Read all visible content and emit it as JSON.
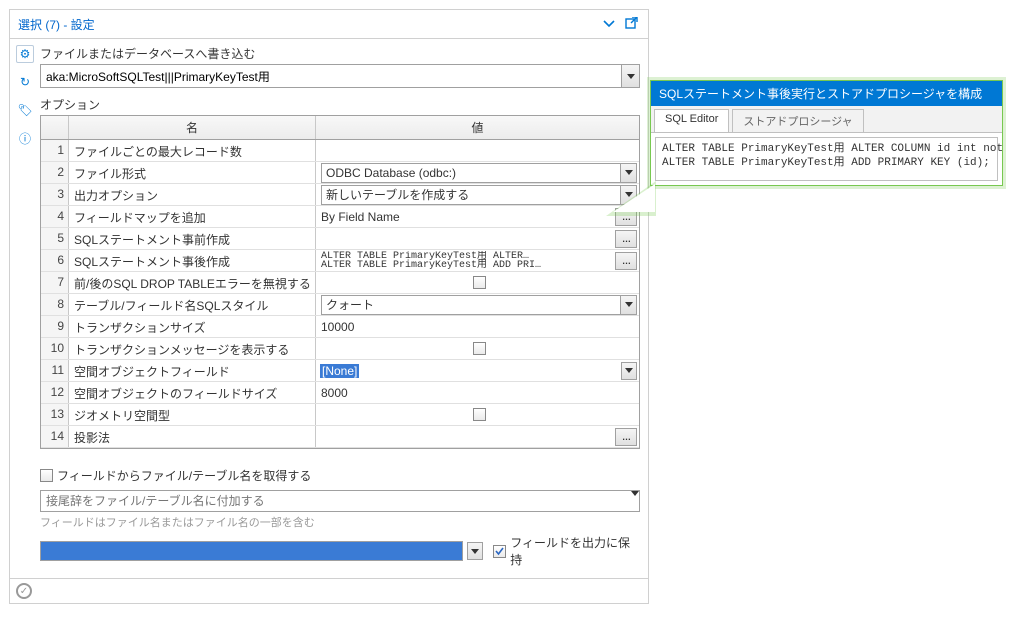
{
  "title": "選択 (7) - 設定",
  "section_write": "ファイルまたはデータベースへ書き込む",
  "target_value": "aka:MicroSoftSQLTest|||PrimaryKeyTest用",
  "options_label": "オプション",
  "col_name": "名",
  "col_value": "値",
  "rows": [
    {
      "n": "1",
      "name": "ファイルごとの最大レコード数",
      "type": "text",
      "value": ""
    },
    {
      "n": "2",
      "name": "ファイル形式",
      "type": "combo",
      "value": "ODBC Database (odbc:)"
    },
    {
      "n": "3",
      "name": "出力オプション",
      "type": "combo",
      "value": "新しいテーブルを作成する"
    },
    {
      "n": "4",
      "name": "フィールドマップを追加",
      "type": "text_btn",
      "value": "By Field Name"
    },
    {
      "n": "5",
      "name": "SQLステートメント事前作成",
      "type": "text_btn",
      "value": ""
    },
    {
      "n": "6",
      "name": "SQLステートメント事後作成",
      "type": "sql_btn",
      "value": "ALTER TABLE PrimaryKeyTest用 ALTER…\nALTER TABLE PrimaryKeyTest用 ADD PRI…"
    },
    {
      "n": "7",
      "name": "前/後のSQL DROP TABLEエラーを無視する",
      "type": "check",
      "value": false
    },
    {
      "n": "8",
      "name": "テーブル/フィールド名SQLスタイル",
      "type": "combo",
      "value": "クォート"
    },
    {
      "n": "9",
      "name": "トランザクションサイズ",
      "type": "text",
      "value": "10000"
    },
    {
      "n": "10",
      "name": "トランザクションメッセージを表示する",
      "type": "check",
      "value": false
    },
    {
      "n": "11",
      "name": "空間オブジェクトフィールド",
      "type": "select_hl",
      "value": "[None]"
    },
    {
      "n": "12",
      "name": "空間オブジェクトのフィールドサイズ",
      "type": "text",
      "value": "8000"
    },
    {
      "n": "13",
      "name": "ジオメトリ空間型",
      "type": "check",
      "value": false
    },
    {
      "n": "14",
      "name": "投影法",
      "type": "text_btn",
      "value": ""
    }
  ],
  "take_from_field": "フィールドからファイル/テーブル名を取得する",
  "suffix_placeholder": "接尾辞をファイル/テーブル名に付加する",
  "hint": "フィールドはファイル名またはファイル名の一部を含む",
  "keep_field": "フィールドを出力に保持",
  "callout": {
    "title": "SQLステートメント事後実行とストアドプロシージャを構成",
    "tab1": "SQL Editor",
    "tab2": "ストアドプロシージャ",
    "sql": "ALTER TABLE PrimaryKeyTest用 ALTER COLUMN id int not null;\nALTER TABLE PrimaryKeyTest用 ADD PRIMARY KEY (id);"
  }
}
